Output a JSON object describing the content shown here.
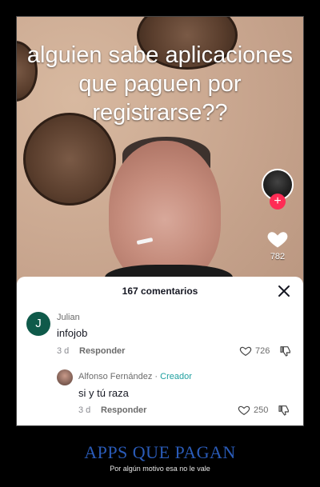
{
  "video": {
    "overlay_text": [
      "alguien sabe aplicaciones",
      "que paguen por",
      "registrarse??"
    ],
    "like_count": "782"
  },
  "comments_sheet": {
    "title": "167 comentarios",
    "comments": [
      {
        "avatar_initial": "J",
        "author": "Julian",
        "text": "infojob",
        "time": "3 d",
        "reply_label": "Responder",
        "likes": "726"
      },
      {
        "author": "Alfonso Fernández",
        "separator": " · ",
        "author_tag": "Creador",
        "text": "si y tú raza",
        "time": "3 d",
        "reply_label": "Responder",
        "likes": "250"
      }
    ]
  },
  "caption": {
    "title": "APPS QUE PAGAN",
    "subtitle": "Por algún motivo esa no le vale"
  },
  "colors": {
    "accent_pink": "#fe2c55",
    "caption_blue": "#2a5bb8",
    "creator_teal": "#1fa0a0",
    "julian_avatar": "#0f5a4a"
  }
}
